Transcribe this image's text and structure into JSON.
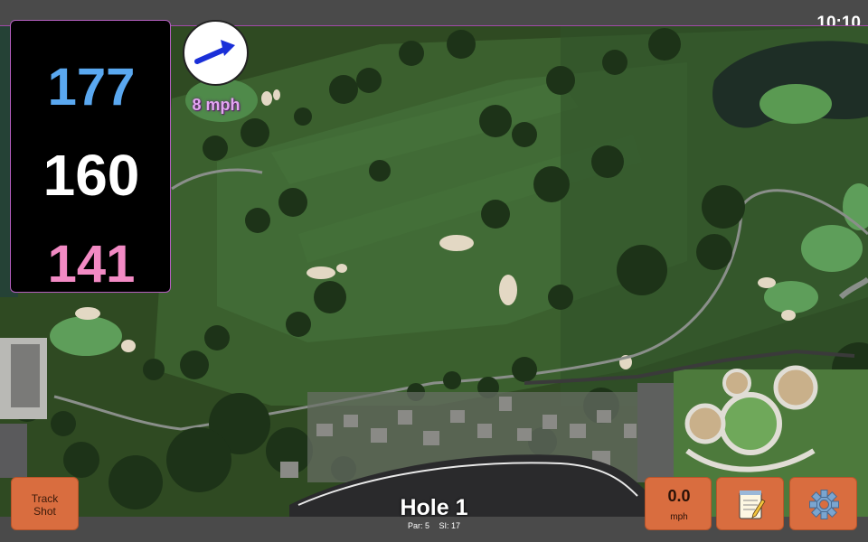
{
  "status": {
    "time": "10:10"
  },
  "distances": {
    "back": "177",
    "middle": "160",
    "front": "141"
  },
  "wind": {
    "speed": "8 mph",
    "icon": "arrow-up-right-icon"
  },
  "hole": {
    "title": "Hole 1",
    "par": "Par: 5",
    "stroke_index": "SI: 17"
  },
  "buttons": {
    "track_shot_line1": "Track",
    "track_shot_line2": "Shot",
    "speed_value": "0.0",
    "speed_unit": "mph",
    "notes_icon": "notepad-icon",
    "settings_icon": "gear-icon"
  },
  "colors": {
    "back": "#5aa8f0",
    "middle": "#ffffff",
    "front": "#f28ac4",
    "button": "#d96d3f",
    "accent": "#b55fc0"
  }
}
